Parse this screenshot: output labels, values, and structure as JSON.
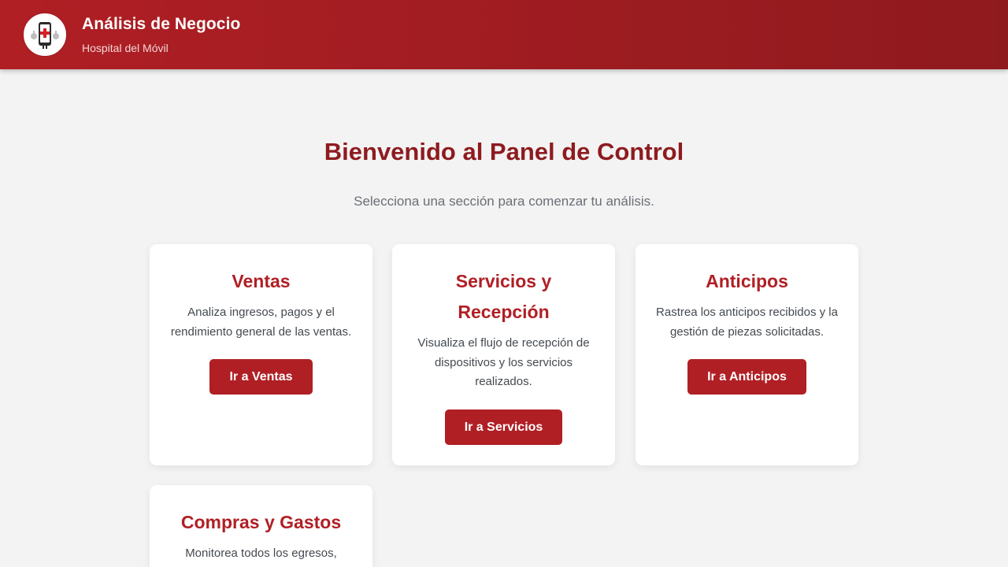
{
  "header": {
    "title": "Análisis de Negocio",
    "subtitle": "Hospital del Móvil",
    "logo_icon": "hospital-phone-logo-icon"
  },
  "welcome": {
    "title": "Bienvenido al Panel de Control",
    "subtitle": "Selecciona una sección para comenzar tu análisis."
  },
  "cards": [
    {
      "title": "Ventas",
      "description": "Analiza ingresos, pagos y el rendimiento general de las ventas.",
      "button": "Ir a Ventas"
    },
    {
      "title": "Servicios y Recepción",
      "description": "Visualiza el flujo de recepción de dispositivos y los servicios realizados.",
      "button": "Ir a Servicios"
    },
    {
      "title": "Anticipos",
      "description": "Rastrea los anticipos recibidos y la gestión de piezas solicitadas.",
      "button": "Ir a Anticipos"
    },
    {
      "title": "Compras y Gastos",
      "description": "Monitorea todos los egresos,",
      "button": ""
    }
  ],
  "colors": {
    "brand_red": "#b01f24",
    "brand_dark_red": "#8e1b1f",
    "background": "#f3f3f3"
  }
}
